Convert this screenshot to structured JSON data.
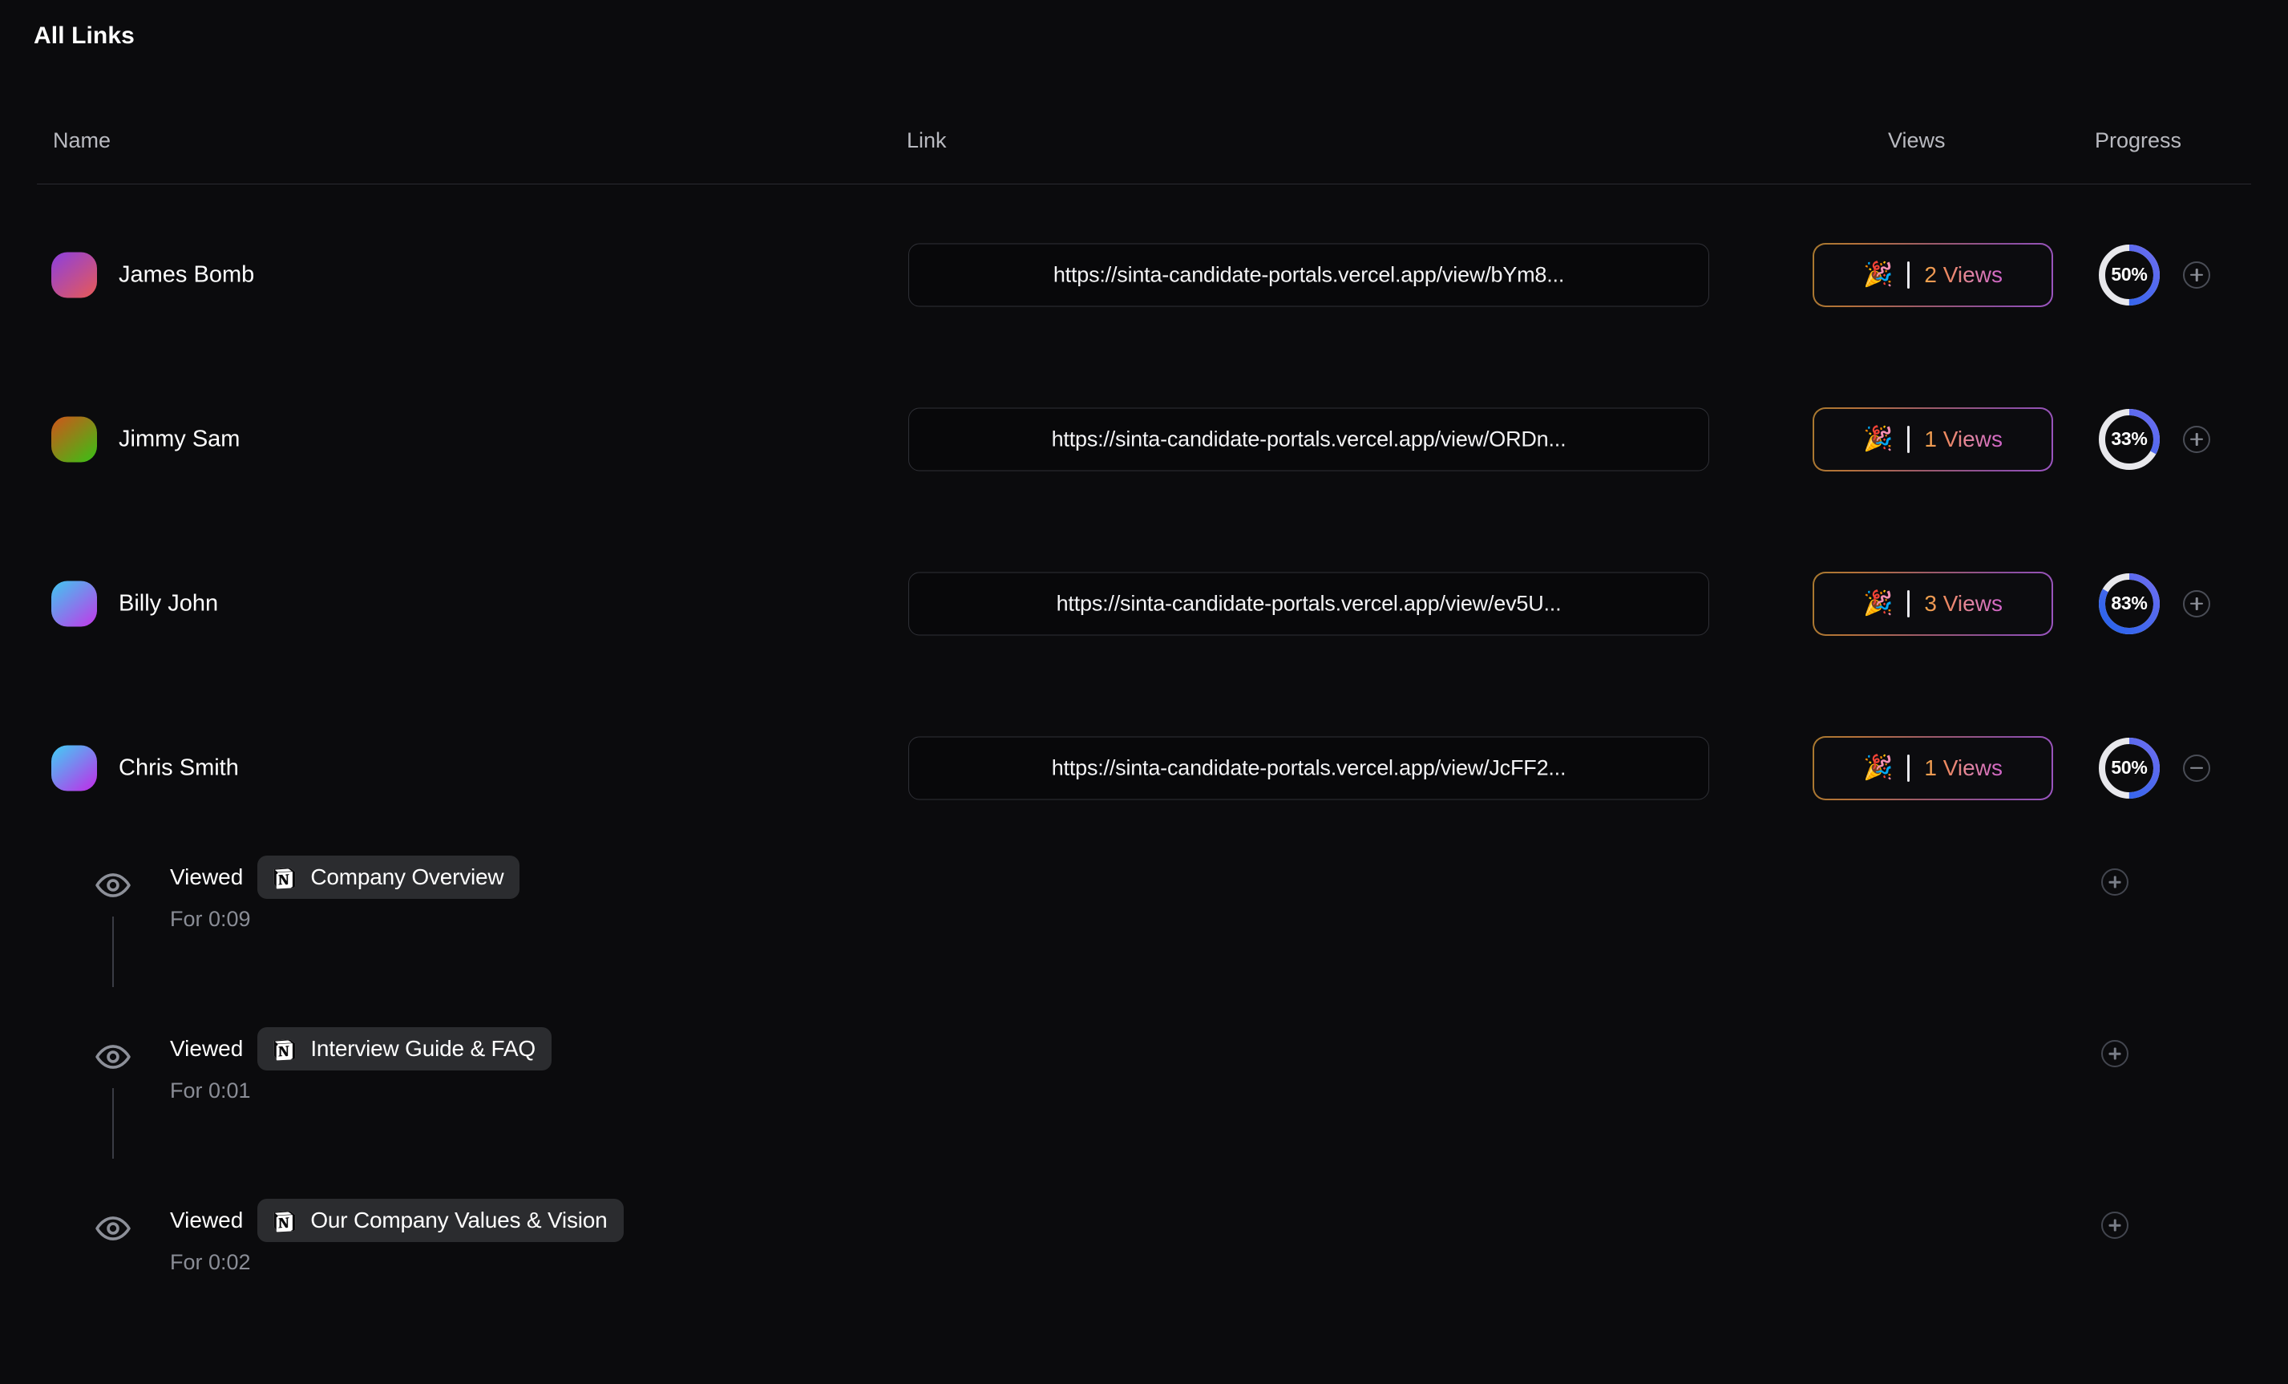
{
  "page": {
    "title": "All Links",
    "background_color": "#0b0b0d"
  },
  "table": {
    "columns": [
      {
        "key": "name",
        "label": "Name"
      },
      {
        "key": "link",
        "label": "Link"
      },
      {
        "key": "views",
        "label": "Views"
      },
      {
        "key": "progress",
        "label": "Progress"
      }
    ],
    "rows": [
      {
        "name": "James Bomb",
        "avatar_gradient": [
          "#8b3fe0",
          "#e85a55"
        ],
        "link": "https://sinta-candidate-portals.vercel.app/view/bYm8...",
        "views_icon": "party-popper-icon",
        "views_label": "2 Views",
        "views_count": 2,
        "progress_percent": 50,
        "progress_label": "50%",
        "toggle_icon": "plus-icon",
        "expanded": false
      },
      {
        "name": "Jimmy Sam",
        "avatar_gradient": [
          "#d1541a",
          "#37c215"
        ],
        "link": "https://sinta-candidate-portals.vercel.app/view/ORDn...",
        "views_icon": "party-popper-icon",
        "views_label": "1 Views",
        "views_count": 1,
        "progress_percent": 33,
        "progress_label": "33%",
        "toggle_icon": "plus-icon",
        "expanded": false
      },
      {
        "name": "Billy John",
        "avatar_gradient": [
          "#3fc8f0",
          "#c337e8"
        ],
        "link": "https://sinta-candidate-portals.vercel.app/view/ev5U...",
        "views_icon": "party-popper-icon",
        "views_label": "3 Views",
        "views_count": 3,
        "progress_percent": 83,
        "progress_label": "83%",
        "toggle_icon": "plus-icon",
        "expanded": false
      },
      {
        "name": "Chris Smith",
        "avatar_gradient": [
          "#3fd0f5",
          "#c22ae8"
        ],
        "link": "https://sinta-candidate-portals.vercel.app/view/JcFF2...",
        "views_icon": "party-popper-icon",
        "views_label": "1 Views",
        "views_count": 1,
        "progress_percent": 50,
        "progress_label": "50%",
        "toggle_icon": "minus-icon",
        "expanded": true
      }
    ]
  },
  "timeline": {
    "items": [
      {
        "event_icon": "eye-icon",
        "verb": "Viewed",
        "source_icon": "notion-icon",
        "document": "Company Overview",
        "duration": "For 0:09",
        "add_icon": "plus-icon"
      },
      {
        "event_icon": "eye-icon",
        "verb": "Viewed",
        "source_icon": "notion-icon",
        "document": "Interview Guide & FAQ",
        "duration": "For 0:01",
        "add_icon": "plus-icon"
      },
      {
        "event_icon": "eye-icon",
        "verb": "Viewed",
        "source_icon": "notion-icon",
        "document": "Our Company Values & Vision",
        "duration": "For 0:02",
        "add_icon": "plus-icon"
      }
    ]
  },
  "colors": {
    "progress_track": "#e8e8ec",
    "progress_fill_start": "#2563eb",
    "progress_fill_end": "#6d6df0",
    "badge_border_start": "#a8792f",
    "badge_border_end": "#9b55c0",
    "text_primary": "#ffffff",
    "text_muted": "#8a8d96"
  }
}
